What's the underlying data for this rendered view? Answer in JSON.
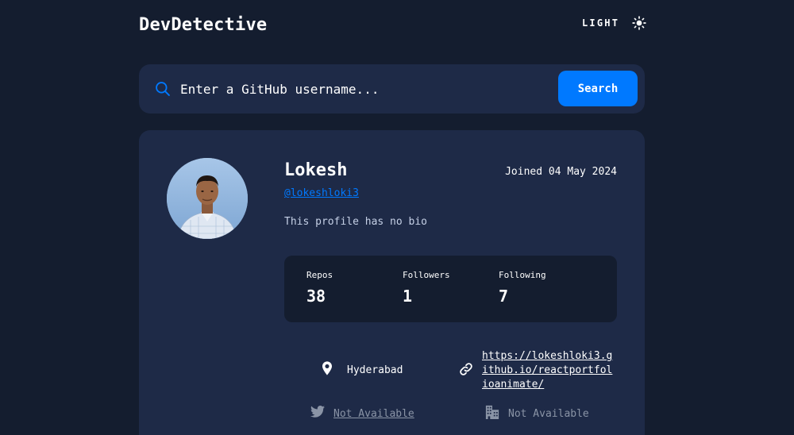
{
  "header": {
    "brand": "DevDetective",
    "theme_label": "LIGHT",
    "theme_icon": "sun-icon"
  },
  "search": {
    "placeholder": "Enter a GitHub username...",
    "button_label": "Search",
    "icon": "search-icon"
  },
  "profile": {
    "name": "Lokesh",
    "login": "@lokeshloki3",
    "joined": "Joined 04 May 2024",
    "bio": "This profile has no bio",
    "stats": [
      {
        "label": "Repos",
        "value": "38"
      },
      {
        "label": "Followers",
        "value": "1"
      },
      {
        "label": "Following",
        "value": "7"
      }
    ],
    "info": {
      "location": "Hyderabad",
      "website_line1": "https://lokeshloki3.g",
      "website_line2": "ithub.io/reactportfol",
      "website_line3": "ioanimate/",
      "twitter": "Not Available",
      "company": "Not Available"
    }
  },
  "colors": {
    "background": "#141d2f",
    "card": "#1e2a47",
    "accent": "#0079ff",
    "muted": "#8a94a6"
  }
}
